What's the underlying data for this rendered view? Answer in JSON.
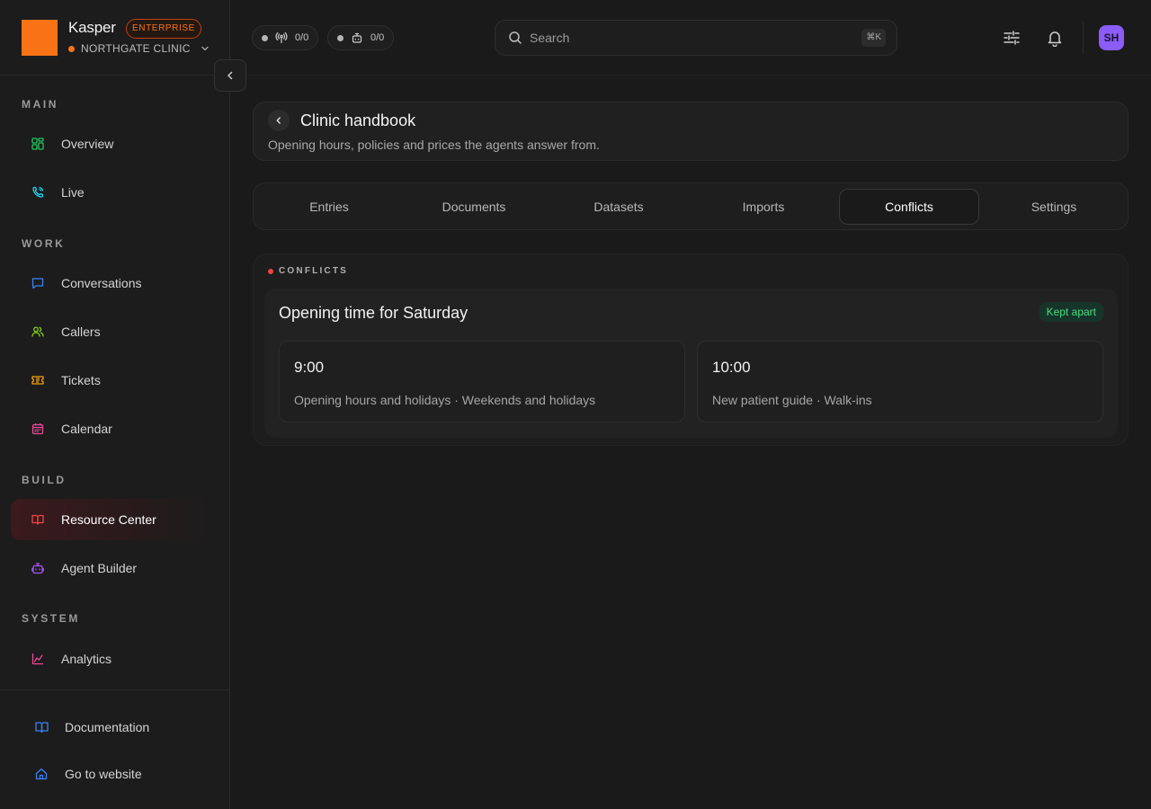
{
  "brand": {
    "name": "Kasper",
    "badge": "ENTERPRISE",
    "org": "NORTHGATE CLINIC"
  },
  "sidebar": {
    "sections": [
      {
        "label": "MAIN"
      },
      {
        "label": "WORK"
      },
      {
        "label": "BUILD"
      },
      {
        "label": "SYSTEM"
      }
    ],
    "items": [
      {
        "label": "Overview",
        "icon": "grid-icon",
        "color": "#22c55e"
      },
      {
        "label": "Live",
        "icon": "phone-icon",
        "color": "#22d3ee"
      },
      {
        "label": "Conversations",
        "icon": "chat-icon",
        "color": "#3b82f6"
      },
      {
        "label": "Callers",
        "icon": "users-icon",
        "color": "#84cc16"
      },
      {
        "label": "Tickets",
        "icon": "ticket-icon",
        "color": "#f59e0b"
      },
      {
        "label": "Calendar",
        "icon": "calendar-icon",
        "color": "#ec4899"
      },
      {
        "label": "Resource Center",
        "icon": "book-icon",
        "color": "#ef4444",
        "active": true
      },
      {
        "label": "Agent Builder",
        "icon": "robot-icon",
        "color": "#a855f7"
      },
      {
        "label": "Analytics",
        "icon": "chart-line-icon",
        "color": "#ec4899"
      }
    ],
    "footer": [
      {
        "label": "Documentation",
        "icon": "book-open-icon",
        "color": "#3b82f6"
      },
      {
        "label": "Go to website",
        "icon": "home-icon",
        "color": "#3b82f6"
      }
    ]
  },
  "topbar": {
    "live_calls": "0/0",
    "agents": "0/0",
    "search_placeholder": "Search",
    "search_shortcut": "⌘K",
    "avatar_initials": "SH"
  },
  "header": {
    "title": "Clinic handbook",
    "subtitle": "Opening hours, policies and prices the agents answer from."
  },
  "tabs": [
    {
      "label": "Entries"
    },
    {
      "label": "Documents"
    },
    {
      "label": "Datasets"
    },
    {
      "label": "Imports"
    },
    {
      "label": "Conflicts",
      "active": true
    },
    {
      "label": "Settings"
    }
  ],
  "conflicts": {
    "section_label": "CONFLICTS",
    "items": [
      {
        "title": "Opening time for Saturday",
        "status": "Kept apart",
        "options": [
          {
            "value": "9:00",
            "source": "Opening hours and holidays · Weekends and holidays"
          },
          {
            "value": "10:00",
            "source": "New patient guide · Walk-ins"
          }
        ]
      }
    ]
  },
  "colors": {
    "accent": "#f97316",
    "active_nav": "#ef4444",
    "status_ok": "#4ade80"
  }
}
